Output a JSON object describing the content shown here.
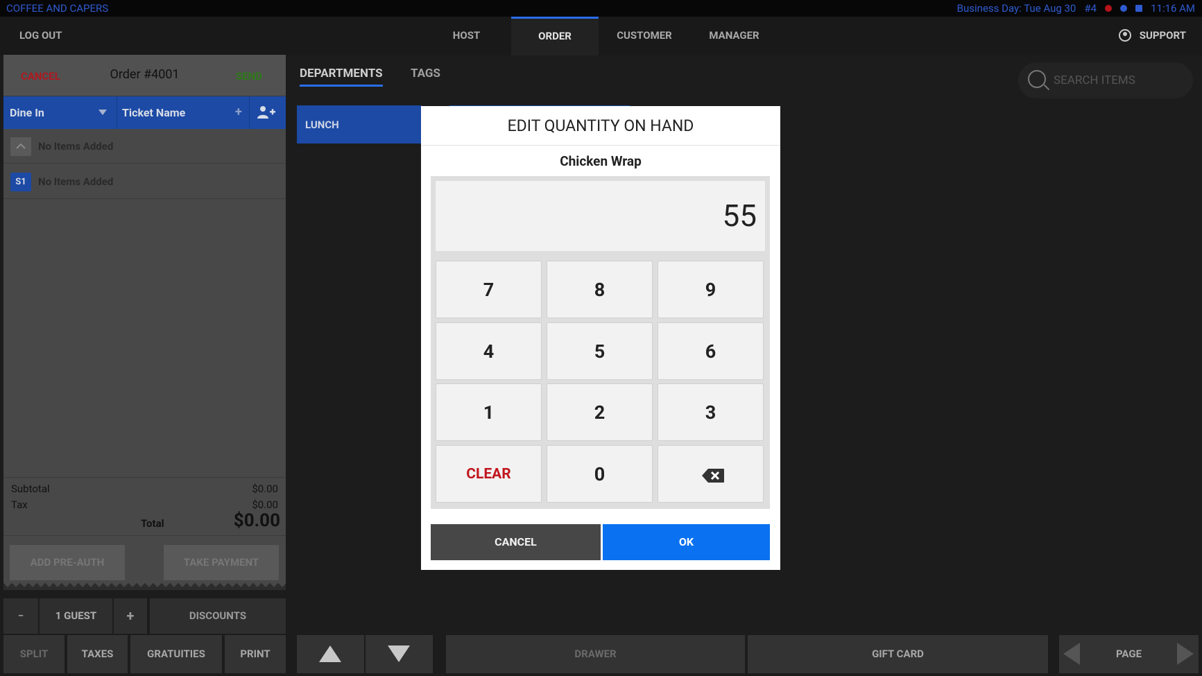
{
  "status_bar": {
    "app_name": "COFFEE AND CAPERS",
    "business_day": "Business Day: Tue Aug 30",
    "terminal": "#4",
    "time": "11:16 AM"
  },
  "top_nav": {
    "logout": "LOG OUT",
    "tabs": [
      "HOST",
      "ORDER",
      "CUSTOMER",
      "MANAGER"
    ],
    "active_tab": "ORDER",
    "support": "SUPPORT"
  },
  "order": {
    "cancel": "CANCEL",
    "title": "Order #4001",
    "send": "SEND",
    "order_type": "Dine In",
    "ticket_name": "Ticket Name",
    "plus": "+",
    "seats": [
      {
        "badge": "",
        "text": "No Items Added"
      },
      {
        "badge": "S1",
        "text": "No Items Added"
      }
    ],
    "subtotal_label": "Subtotal",
    "subtotal": "$0.00",
    "tax_label": "Tax",
    "tax": "$0.00",
    "total_label": "Total",
    "total": "$0.00",
    "add_preauth": "ADD PRE-AUTH",
    "take_payment": "TAKE PAYMENT"
  },
  "guest_row": {
    "minus": "−",
    "guests": "1 GUEST",
    "plus": "+",
    "discounts": "DISCOUNTS"
  },
  "bottom_left": [
    "SPLIT",
    "TAXES",
    "GRATUITIES",
    "PRINT"
  ],
  "departments": {
    "tabs": [
      "DEPARTMENTS",
      "TAGS"
    ],
    "active": "DEPARTMENTS",
    "search_placeholder": "SEARCH ITEMS",
    "items": [
      "LUNCH"
    ]
  },
  "bottom_right": {
    "drawer": "DRAWER",
    "gift_card": "GIFT CARD",
    "page": "PAGE"
  },
  "modal": {
    "title": "EDIT QUANTITY ON HAND",
    "item_name": "Chicken Wrap",
    "value": "55",
    "keys": [
      "7",
      "8",
      "9",
      "4",
      "5",
      "6",
      "1",
      "2",
      "3",
      "CLEAR",
      "0",
      "backspace"
    ],
    "cancel": "CANCEL",
    "ok": "OK"
  },
  "colors": {
    "accent_blue": "#0a72f0",
    "ticket_blue": "#1c4aa5",
    "cancel_red": "#c2161e",
    "send_green": "#2d7a17"
  }
}
